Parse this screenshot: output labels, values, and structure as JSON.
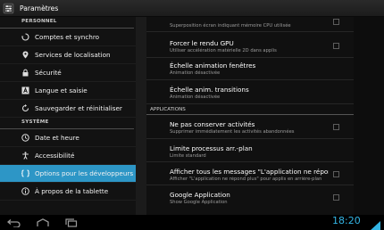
{
  "app": {
    "title": "Paramètres",
    "icon": "settings-app-icon"
  },
  "left_pane": {
    "sections": [
      {
        "header": "PERSONNEL",
        "items": [
          {
            "label": "Comptes et synchro",
            "icon": "sync-icon"
          },
          {
            "label": "Services de localisation",
            "icon": "location-icon"
          },
          {
            "label": "Sécurité",
            "icon": "lock-icon"
          },
          {
            "label": "Langue et saisie",
            "icon": "language-icon"
          },
          {
            "label": "Sauvegarder et réinitialiser",
            "icon": "backup-icon"
          }
        ]
      },
      {
        "header": "SYSTÈME",
        "items": [
          {
            "label": "Date et heure",
            "icon": "clock-icon"
          },
          {
            "label": "Accessibilité",
            "icon": "accessibility-icon"
          },
          {
            "label": "Options pour les développeurs",
            "icon": "developer-icon",
            "selected": true
          },
          {
            "label": "À propos de la tablette",
            "icon": "info-icon"
          }
        ]
      }
    ]
  },
  "right_pane": {
    "top_summary": "Superposition écran indiquant mémoire CPU utilisée",
    "prefs": [
      {
        "title": "Forcer le rendu GPU",
        "summary": "Utiliser accélération matérielle 2D dans applis",
        "checkbox": true,
        "checked": false
      },
      {
        "title": "Échelle animation fenêtres",
        "summary": "Animation désactivée",
        "checkbox": false
      },
      {
        "title": "Échelle anim. transitions",
        "summary": "Animation désactivée",
        "checkbox": false
      }
    ],
    "category": "APPLICATIONS",
    "app_prefs": [
      {
        "title": "Ne pas conserver activités",
        "summary": "Supprimer immédiatement les activités abandonnées",
        "checkbox": true,
        "checked": false
      },
      {
        "title": "Limite processus arr.-plan",
        "summary": "Limite standard",
        "checkbox": false
      },
      {
        "title": "Afficher tous les messages \"L'application ne répond",
        "summary": "Afficher \"L'application ne répond plus\" pour applis en arrière-plan",
        "checkbox": true,
        "checked": false
      },
      {
        "title": "Google Application",
        "summary": "Show Google Application",
        "checkbox": true,
        "checked": false
      }
    ]
  },
  "status_bar": {
    "clock": "18:20",
    "nav_buttons": [
      "back-icon",
      "home-icon",
      "recent-apps-icon"
    ],
    "indicators": [
      "signal-icon"
    ]
  },
  "colors": {
    "accent": "#2d96c6",
    "clock": "#33b5e5"
  }
}
